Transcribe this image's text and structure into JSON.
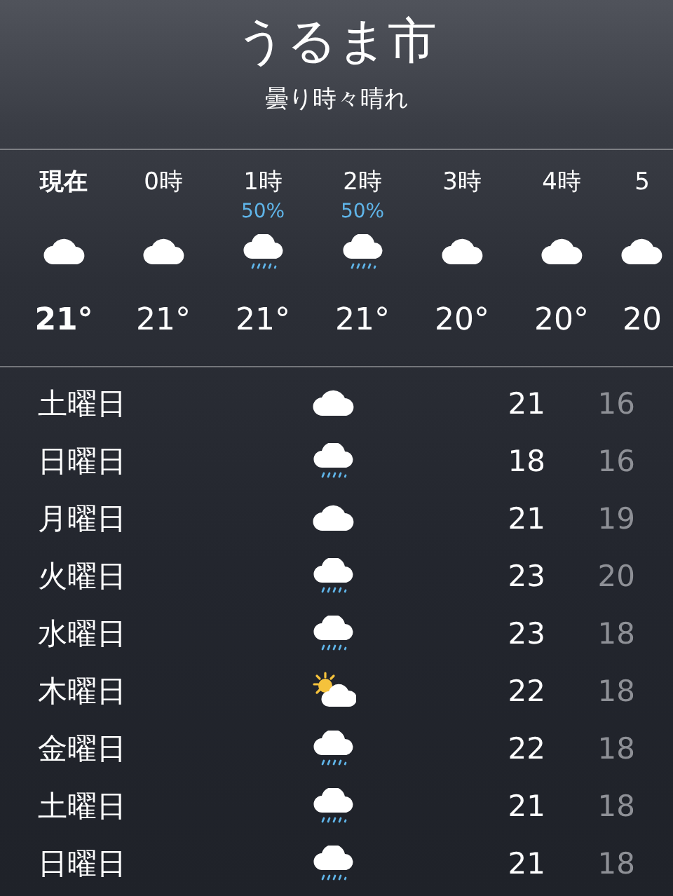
{
  "location": {
    "city": "うるま市",
    "condition": "曇り時々晴れ"
  },
  "hourly": [
    {
      "time": "現在",
      "now": true,
      "kind": "cloud",
      "temp": "21°"
    },
    {
      "time": "0時",
      "now": false,
      "kind": "cloud",
      "temp": "21°"
    },
    {
      "time": "1時",
      "now": false,
      "precip": "50%",
      "kind": "rain",
      "temp": "21°"
    },
    {
      "time": "2時",
      "now": false,
      "precip": "50%",
      "kind": "rain",
      "temp": "21°"
    },
    {
      "time": "3時",
      "now": false,
      "kind": "cloud",
      "temp": "20°"
    },
    {
      "time": "4時",
      "now": false,
      "kind": "cloud",
      "temp": "20°"
    },
    {
      "time": "5",
      "now": false,
      "kind": "cloud",
      "temp": "20"
    }
  ],
  "daily": [
    {
      "day": "土曜日",
      "kind": "cloud",
      "high": "21",
      "low": "16"
    },
    {
      "day": "日曜日",
      "kind": "rain",
      "high": "18",
      "low": "16"
    },
    {
      "day": "月曜日",
      "kind": "cloud",
      "high": "21",
      "low": "19"
    },
    {
      "day": "火曜日",
      "kind": "rain",
      "high": "23",
      "low": "20"
    },
    {
      "day": "水曜日",
      "kind": "rain",
      "high": "23",
      "low": "18"
    },
    {
      "day": "木曜日",
      "kind": "partly-sunny",
      "high": "22",
      "low": "18"
    },
    {
      "day": "金曜日",
      "kind": "rain",
      "high": "22",
      "low": "18"
    },
    {
      "day": "土曜日",
      "kind": "rain",
      "high": "21",
      "low": "18"
    },
    {
      "day": "日曜日",
      "kind": "rain",
      "high": "21",
      "low": "18"
    }
  ]
}
